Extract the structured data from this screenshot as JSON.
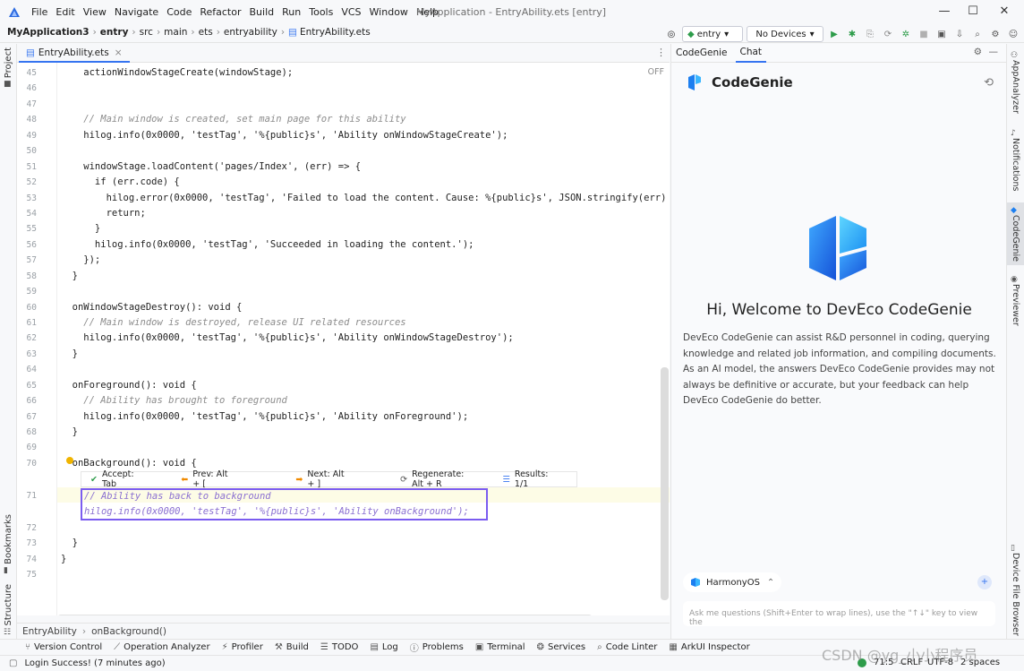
{
  "menu": [
    "File",
    "Edit",
    "View",
    "Navigate",
    "Code",
    "Refactor",
    "Build",
    "Run",
    "Tools",
    "VCS",
    "Window",
    "Help"
  ],
  "window_title": "MyApplication - EntryAbility.ets [entry]",
  "window_controls": {
    "minimize": "—",
    "maximize": "☐",
    "close": "✕"
  },
  "breadcrumb": [
    "MyApplication3",
    "entry",
    "src",
    "main",
    "ets",
    "entryability",
    "EntryAbility.ets"
  ],
  "toolbar": {
    "module": "entry",
    "device": "No Devices"
  },
  "left_tools": {
    "project": "Project",
    "bookmarks": "Bookmarks",
    "structure": "Structure"
  },
  "editor": {
    "tab": "EntryAbility.ets",
    "off_label": "OFF",
    "line_numbers": [
      "45",
      "46",
      "47",
      "48",
      "49",
      "50",
      "51",
      "52",
      "53",
      "54",
      "55",
      "56",
      "57",
      "58",
      "59",
      "60",
      "61",
      "62",
      "63",
      "64",
      "65",
      "66",
      "67",
      "68",
      "69",
      "70",
      "71",
      "72",
      "73",
      "74",
      "75"
    ],
    "lines": {
      "45": "    actionWindowStageCreate(windowStage);",
      "48": "    // Main window is created, set main page for this ability",
      "49": "    hilog.info(0x0000, 'testTag', '%{public}s', 'Ability onWindowStageCreate');",
      "51": "    windowStage.loadContent('pages/Index', (err) => {",
      "52": "      if (err.code) {",
      "53": "        hilog.error(0x0000, 'testTag', 'Failed to load the content. Cause: %{public}s', JSON.stringify(err)",
      "54": "        return;",
      "55": "      }",
      "56": "      hilog.info(0x0000, 'testTag', 'Succeeded in loading the content.');",
      "57": "    });",
      "58": "  }",
      "60": "  onWindowStageDestroy(): void {",
      "61": "    // Main window is destroyed, release UI related resources",
      "62": "    hilog.info(0x0000, 'testTag', '%{public}s', 'Ability onWindowStageDestroy');",
      "63": "  }",
      "65": "  onForeground(): void {",
      "66": "    // Ability has brought to foreground",
      "67": "    hilog.info(0x0000, 'testTag', '%{public}s', 'Ability onForeground');",
      "68": "  }",
      "70": "  onBackground(): void {",
      "73": "  }",
      "74": "}"
    },
    "ghost_line_1": "// Ability has back to background",
    "ghost_line_2": "hilog.info(0x0000, 'testTag', '%{public}s', 'Ability onBackground');",
    "suggest": {
      "accept": "Accept: Tab",
      "prev": "Prev: Alt + [",
      "next": "Next: Alt + ]",
      "regenerate": "Regenerate: Alt + R",
      "results": "Results: 1/1"
    },
    "footer": [
      "EntryAbility",
      "onBackground()"
    ]
  },
  "right_panel": {
    "tabs": [
      "CodeGenie",
      "Chat"
    ],
    "brand": "CodeGenie",
    "welcome": "Hi, Welcome to DevEco CodeGenie",
    "intro": "DevEco CodeGenie can assist R&D personnel in coding, querying knowledge and related job information, and compiling documents. As an AI model, the answers DevEco CodeGenie provides may not always be definitive or accurate, but your feedback can help DevEco CodeGenie do better.",
    "os_chip": "HarmonyOS",
    "input_placeholder": "Ask me questions (Shift+Enter to wrap lines), use the \"↑↓\" key to view the"
  },
  "right_tools": [
    "AppAnalyzer",
    "Notifications",
    "CodeGenie",
    "Previewer",
    "Device File Browser"
  ],
  "bottom_tools": [
    "Version Control",
    "Operation Analyzer",
    "Profiler",
    "Build",
    "TODO",
    "Log",
    "Problems",
    "Terminal",
    "Services",
    "Code Linter",
    "ArkUI Inspector"
  ],
  "status": {
    "message": "Login Success! (7 minutes ago)",
    "position": "71:5",
    "line_sep": "CRLF",
    "encoding": "UTF-8",
    "indent": "2 spaces"
  },
  "watermark": "CSDN @yg_小小程序员",
  "colors": {
    "accent": "#3574f0",
    "ghost_border": "#7b5cf0",
    "brand_blue": "#1d7ff0"
  }
}
